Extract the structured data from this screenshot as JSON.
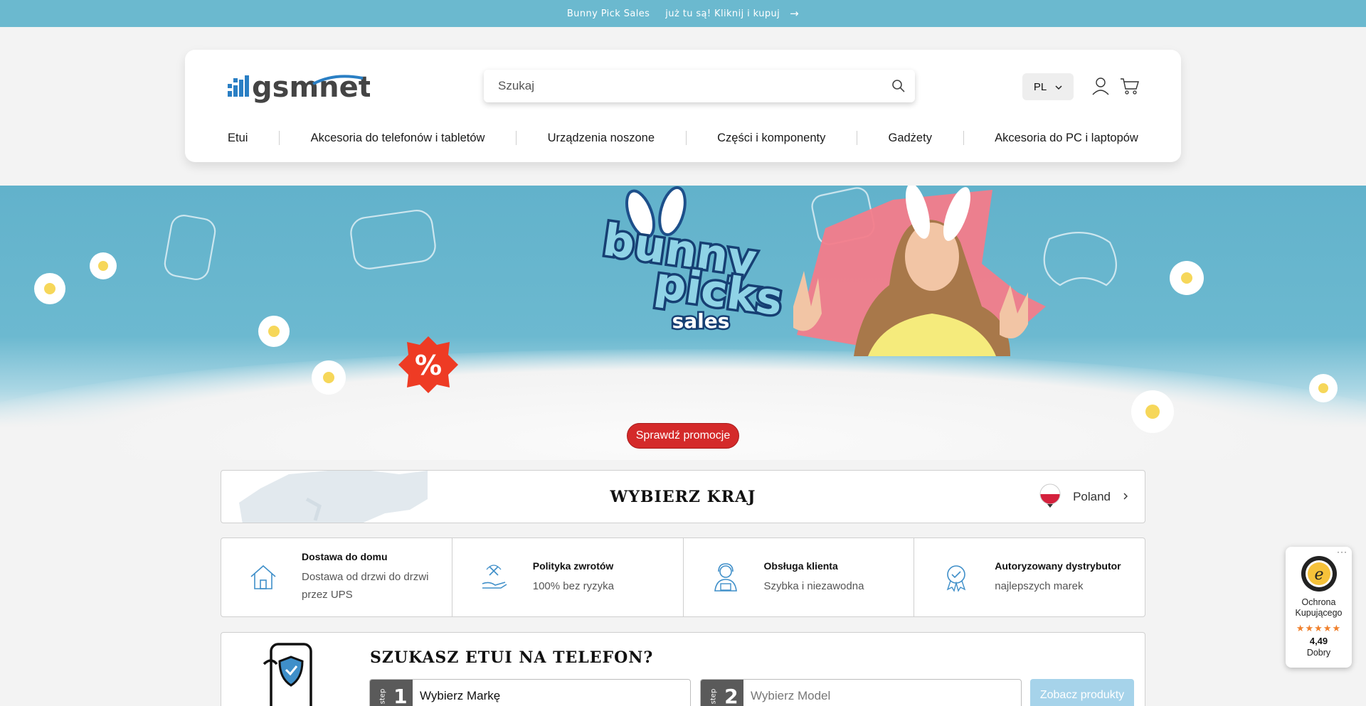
{
  "announcement": {
    "left_text": "Bunny Pick Sales",
    "right_text": "już tu są! Kliknij i kupuj"
  },
  "header": {
    "logo_text": "gsmnet",
    "search": {
      "placeholder": "Szukaj"
    },
    "language": "PL",
    "nav": [
      "Etui",
      "Akcesoria do telefonów i tabletów",
      "Urządzenia noszone",
      "Części i komponenty",
      "Gadżety",
      "Akcesoria do PC i laptopów"
    ]
  },
  "hero": {
    "brand_line1": "bunny",
    "brand_line2": "picks",
    "brand_line3": "sales",
    "badge": "%",
    "cta_label": "Sprawdź promocje"
  },
  "country": {
    "title": "WYBIERZ KRAJ",
    "selected": "Poland"
  },
  "features": [
    {
      "title": "Dostawa do domu",
      "desc": "Dostawa od drzwi do drzwi przez UPS"
    },
    {
      "title": "Polityka zwrotów",
      "desc": "100% bez ryzyka"
    },
    {
      "title": "Obsługa klienta",
      "desc": "Szybka i niezawodna"
    },
    {
      "title": "Autoryzowany dystrybutor",
      "desc": "najlepszych marek"
    }
  ],
  "finder": {
    "title": "SZUKASZ ETUI NA TELEFON?",
    "step_label": "step",
    "step1_num": "1",
    "step1_value": "Wybierz Markę",
    "step2_num": "2",
    "step2_placeholder": "Wybierz Model",
    "button": "Zobacz produkty"
  },
  "trust_badge": {
    "dots": "···",
    "label_line1": "Ochrona",
    "label_line2": "Kupującego",
    "stars": "★★★★★",
    "score": "4,49",
    "rating_word": "Dobry"
  },
  "colors": {
    "announce_bg": "#6bb9cf",
    "hero_sky": "#62b2cb",
    "cta": "#d42a2a",
    "show_products": "#a6d3ea",
    "logo_blue": "#2a7fc4"
  }
}
